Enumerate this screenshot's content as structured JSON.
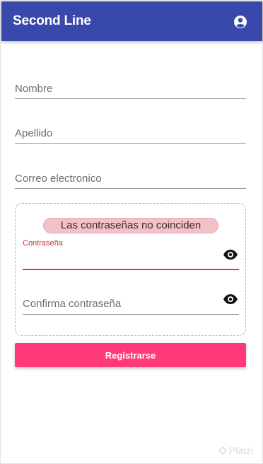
{
  "appbar": {
    "title": "Second Line",
    "account_icon": "account-circle-icon",
    "color": "#3949ab"
  },
  "form": {
    "fields": [
      {
        "label": "Nombre"
      },
      {
        "label": "Apellido"
      },
      {
        "label": "Correo electronico"
      }
    ],
    "password_group": {
      "error_message": "Las contraseñas no coinciden",
      "password_label": "Contraseña",
      "password_value": "",
      "confirm_label": "Confirma contraseña",
      "confirm_value": "",
      "toggle_icon": "eye-icon",
      "error_color": "#e53935"
    },
    "submit_label": "Registrarse",
    "submit_color": "#ff3977"
  },
  "watermark": {
    "text": "Platzi"
  }
}
